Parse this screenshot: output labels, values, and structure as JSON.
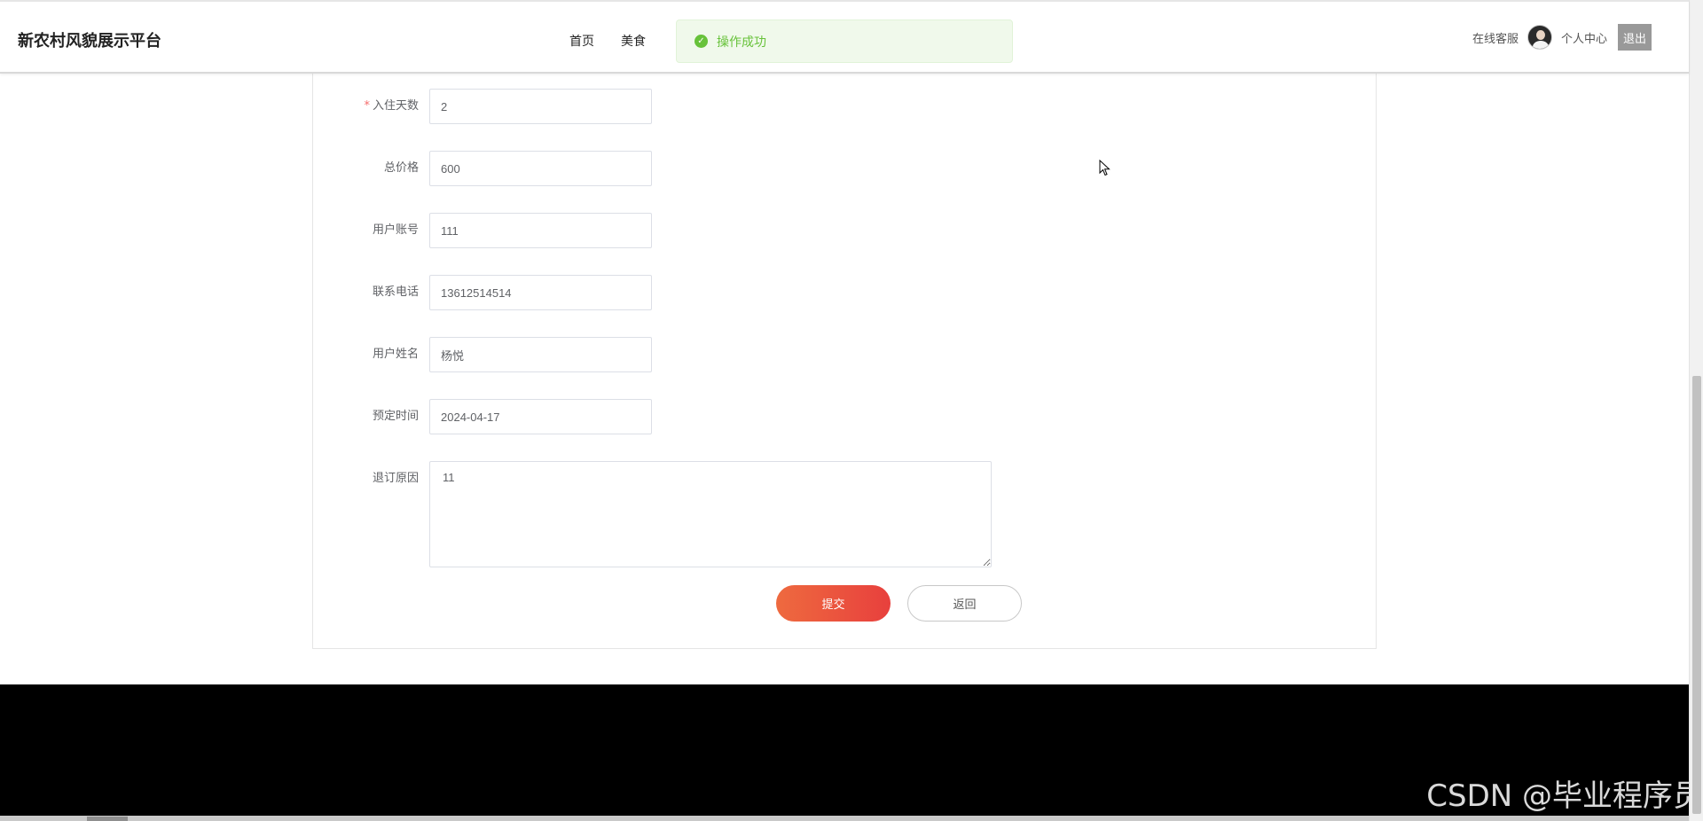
{
  "header": {
    "site_title": "新农村风貌展示平台",
    "nav": [
      {
        "label": "首页"
      },
      {
        "label": "美食"
      }
    ],
    "toast": {
      "message": "操作成功",
      "color": "#67c23a"
    },
    "online_service": "在线客服",
    "personal_center": "个人中心",
    "logout": "退出"
  },
  "form": {
    "fields": [
      {
        "label": "入住天数",
        "value": "2",
        "required": true
      },
      {
        "label": "总价格",
        "value": "600",
        "required": false
      },
      {
        "label": "用户账号",
        "value": "111",
        "required": false
      },
      {
        "label": "联系电话",
        "value": "13612514514",
        "required": false
      },
      {
        "label": "用户姓名",
        "value": "杨悦",
        "required": false
      },
      {
        "label": "预定时间",
        "value": "2024-04-17",
        "required": false
      }
    ],
    "reason_label": "退订原因",
    "reason_value": "11",
    "submit_label": "提交",
    "back_label": "返回",
    "submit_color": "#e8403d"
  },
  "watermark": "CSDN @毕业程序员"
}
